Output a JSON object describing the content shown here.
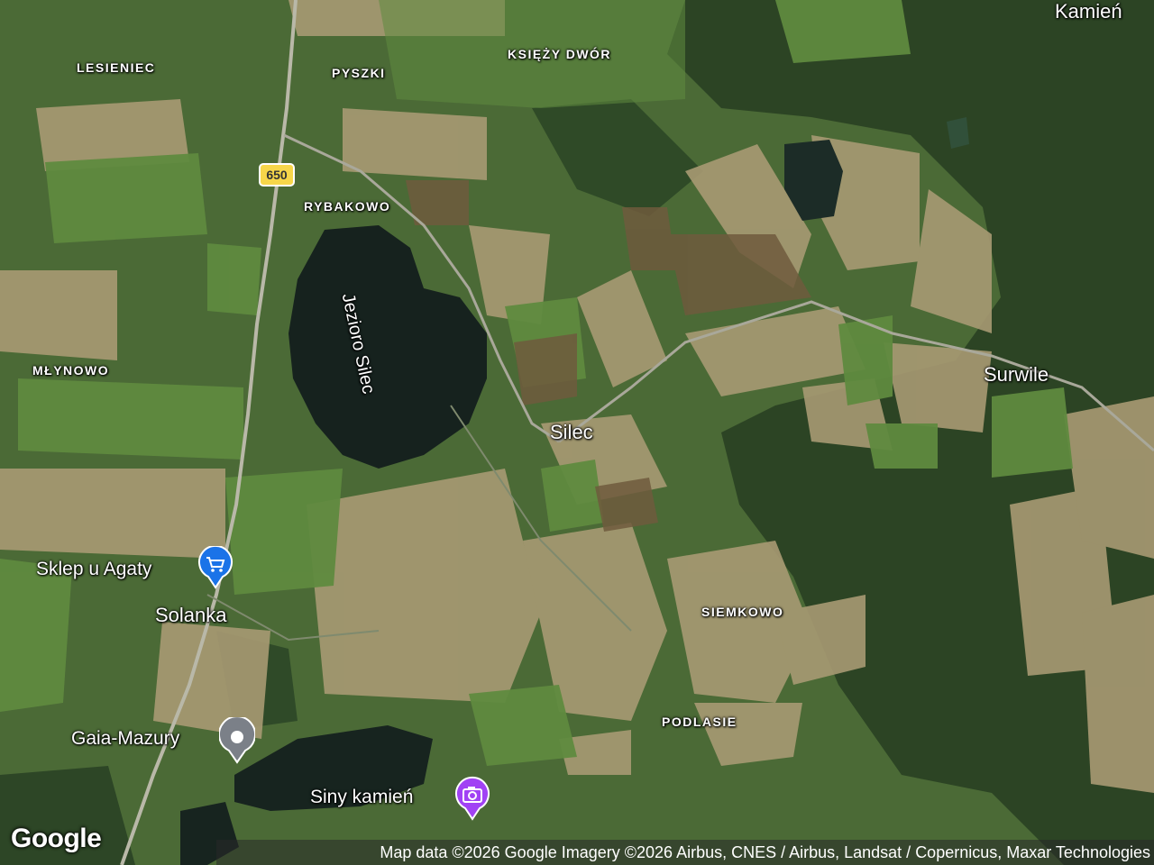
{
  "map": {
    "place_labels": [
      {
        "key": "kamien",
        "text": "Kamień"
      },
      {
        "key": "lesieniec",
        "text": "LESIENIEC"
      },
      {
        "key": "pyszki",
        "text": "PYSZKI"
      },
      {
        "key": "ksiezy_dwor",
        "text": "KSIĘŻY DWÓR"
      },
      {
        "key": "rybakowo",
        "text": "RYBAKOWO"
      },
      {
        "key": "mlynowo",
        "text": "MŁYNOWO"
      },
      {
        "key": "surwile",
        "text": "Surwile"
      },
      {
        "key": "silec",
        "text": "Silec"
      },
      {
        "key": "siemkowo",
        "text": "SIEMKOWO"
      },
      {
        "key": "podlasie",
        "text": "PODLASIE"
      },
      {
        "key": "solanka",
        "text": "Solanka"
      }
    ],
    "lake_label": "Jezioro Silec",
    "route_shield": "650",
    "pois": [
      {
        "key": "sklep",
        "label": "Sklep u Agaty",
        "icon": "shopping-cart-icon",
        "color": "#1a73e8"
      },
      {
        "key": "gaia",
        "label": "Gaia-Mazury",
        "icon": "location-dot-icon",
        "color": "#7b8088"
      },
      {
        "key": "siny",
        "label": "Siny kamień",
        "icon": "camera-icon",
        "color": "#a142f4"
      }
    ],
    "google_logo": "Google",
    "attribution": "Map data ©2026 Google Imagery ©2026 Airbus, CNES / Airbus, Landsat / Copernicus, Maxar Technologies"
  }
}
